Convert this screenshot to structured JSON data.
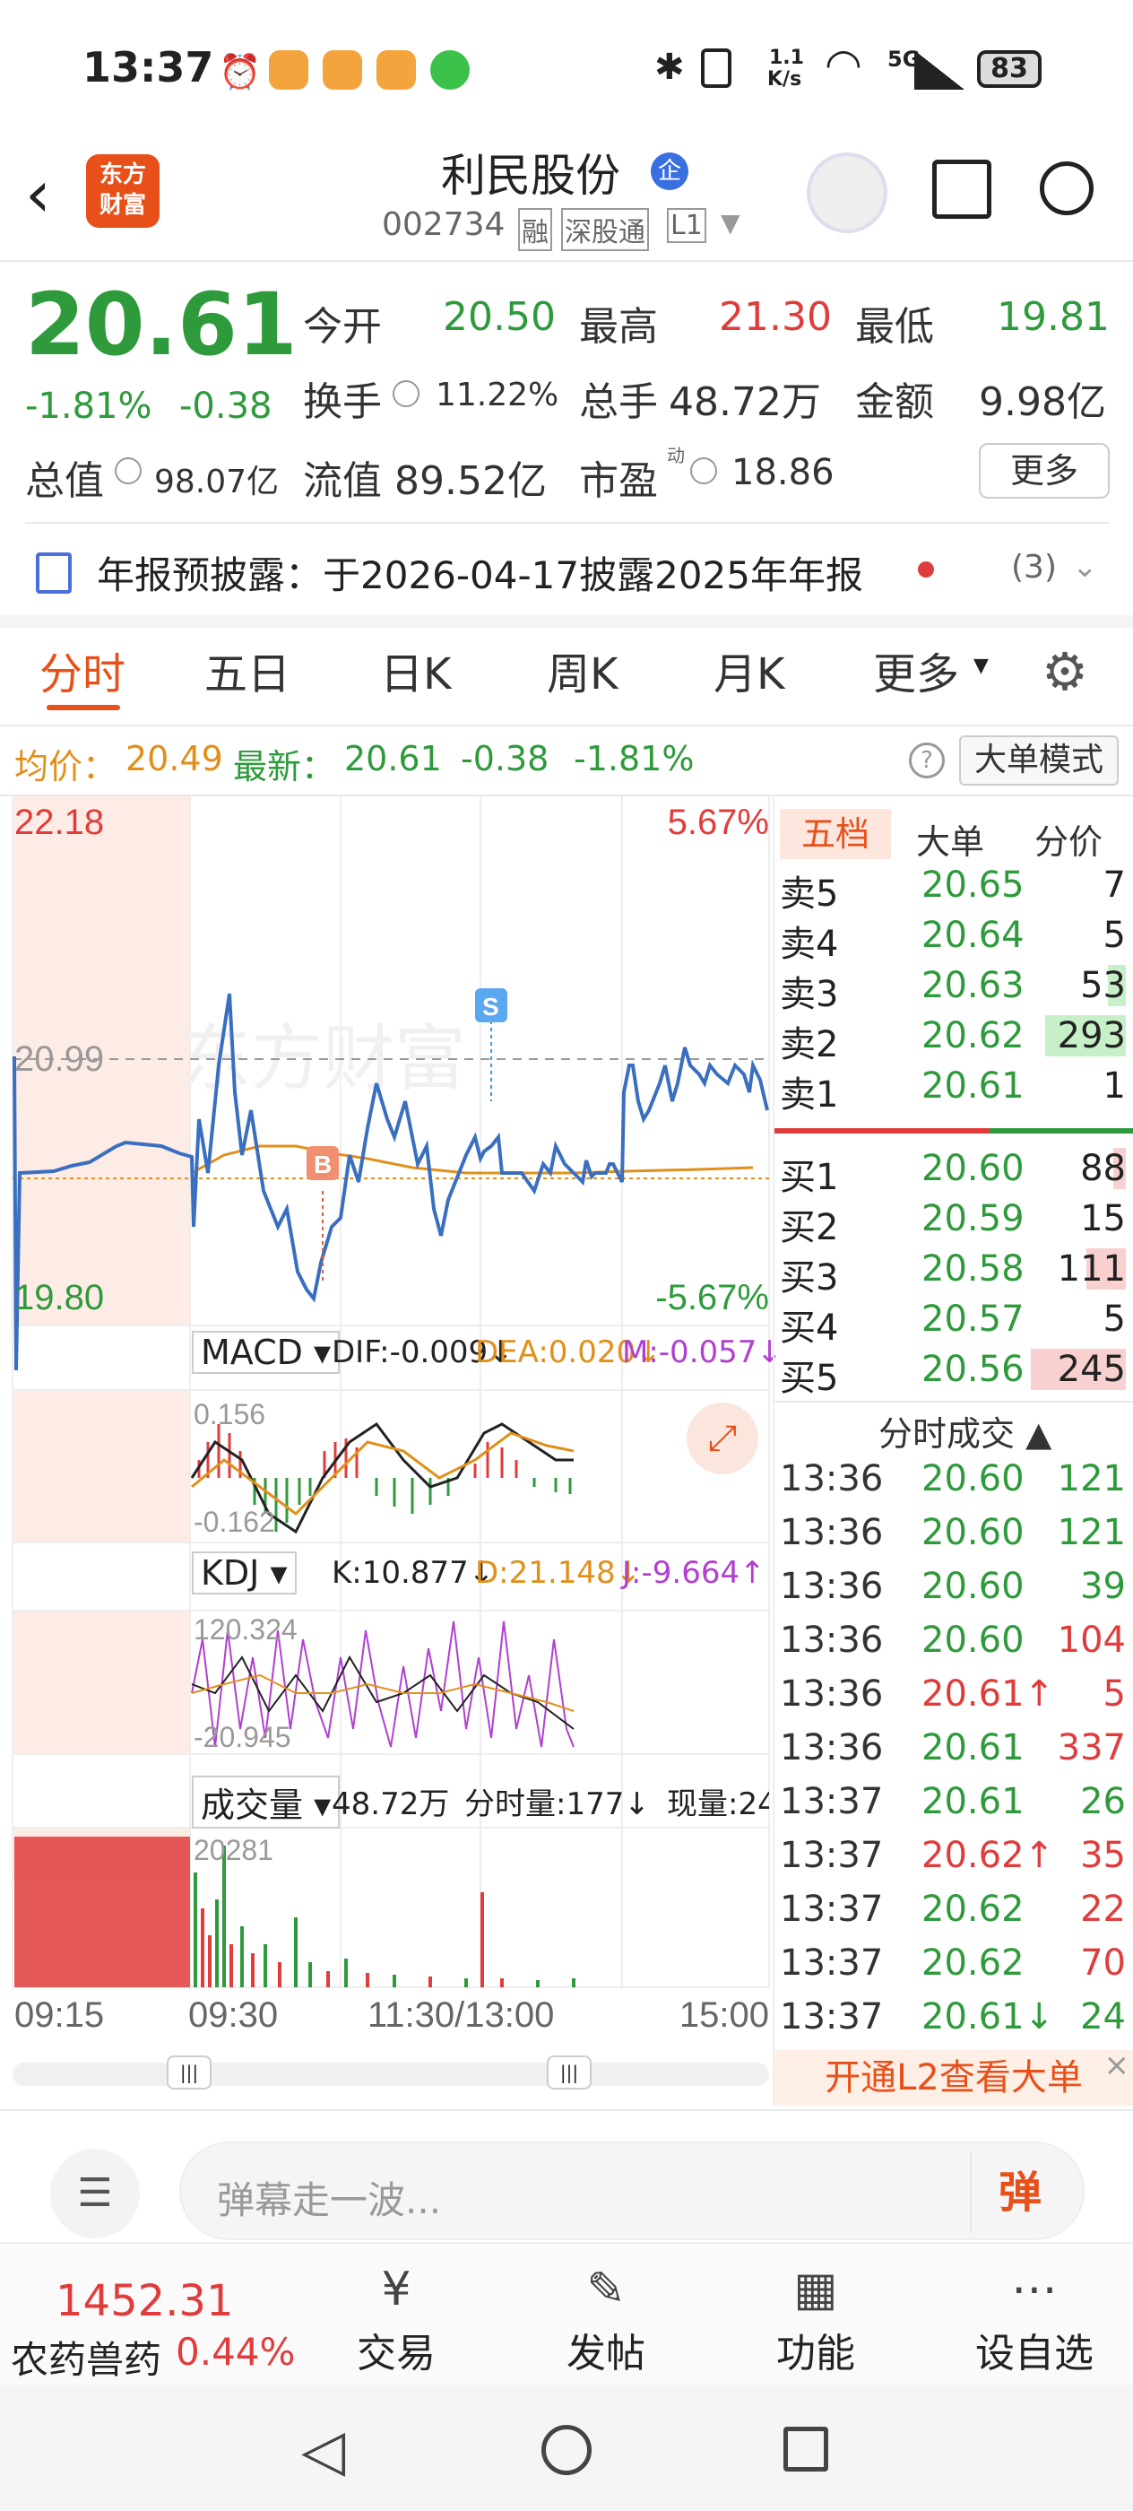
{
  "status": {
    "time": "13:37",
    "net_top": "1.1",
    "net_bottom": "K/s",
    "net_type": "5G",
    "battery": "83"
  },
  "header": {
    "logo_line1": "东方",
    "logo_line2": "财富",
    "stock_name": "利民股份",
    "badge": "企",
    "code": "002734",
    "tag1": "融",
    "tag2": "深股通",
    "tag3": "L1"
  },
  "quote": {
    "price": "20.61",
    "change_pct": "-1.81%",
    "change": "-0.38",
    "open_label": "今开",
    "open": "20.50",
    "high_label": "最高",
    "high": "21.30",
    "low_label": "最低",
    "low": "19.81",
    "turnover_label": "换手",
    "turnover": "11.22%",
    "volume_label": "总手",
    "volume": "48.72万",
    "amount_label": "金额",
    "amount": "9.98亿",
    "mktcap_label": "总值",
    "mktcap": "98.07亿",
    "float_label": "流值",
    "float_cap": "89.52亿",
    "pe_label": "市盈",
    "pe_sup": "动",
    "pe": "18.86",
    "more": "更多"
  },
  "notice": {
    "text": "年报预披露：于2026-04-17披露2025年年报",
    "count": "(3)"
  },
  "tabs": [
    "分时",
    "五日",
    "日K",
    "周K",
    "月K",
    "更多"
  ],
  "avg_bar": {
    "avg_label": "均价：",
    "avg": "20.49",
    "latest_label": "最新：",
    "latest": "20.61",
    "chg": "-0.38",
    "chg_pct": "-1.81%",
    "mode": "大单模式"
  },
  "chart_labels": {
    "ymax": "22.18",
    "ymid": "20.99",
    "ymin": "19.80",
    "pmax": "5.67%",
    "pmin": "-5.67%",
    "watermark": "东方财富",
    "buy_marker": "B",
    "sell_marker": "S"
  },
  "macd": {
    "name": "MACD",
    "dif": "DIF:-0.009↓",
    "dea": "DEA:0.020↓",
    "m": "M:-0.057↓",
    "top": "0.156",
    "bottom": "-0.162"
  },
  "kdj": {
    "name": "KDJ",
    "k": "K:10.877↓",
    "d": "D:21.148↓",
    "j": "J:-9.664↑",
    "top": "120.324",
    "bottom": "-20.945"
  },
  "vol": {
    "name": "成交量",
    "total": "48.72万",
    "bar_label": "分时量:177↓",
    "now_label": "现量:24",
    "top": "20281"
  },
  "xaxis": [
    "09:15",
    "09:30",
    "11:30/13:00",
    "15:00"
  ],
  "orderbook": {
    "tabs": [
      "五档",
      "大单",
      "分价"
    ],
    "asks": [
      {
        "label": "卖5",
        "price": "20.65",
        "vol": "7"
      },
      {
        "label": "卖4",
        "price": "20.64",
        "vol": "5"
      },
      {
        "label": "卖3",
        "price": "20.63",
        "vol": "53"
      },
      {
        "label": "卖2",
        "price": "20.62",
        "vol": "293"
      },
      {
        "label": "卖1",
        "price": "20.61",
        "vol": "1"
      }
    ],
    "bids": [
      {
        "label": "买1",
        "price": "20.60",
        "vol": "88"
      },
      {
        "label": "买2",
        "price": "20.59",
        "vol": "15"
      },
      {
        "label": "买3",
        "price": "20.58",
        "vol": "111"
      },
      {
        "label": "买4",
        "price": "20.57",
        "vol": "5"
      },
      {
        "label": "买5",
        "price": "20.56",
        "vol": "245"
      }
    ]
  },
  "trades": {
    "title": "分时成交",
    "rows": [
      {
        "t": "13:36",
        "p": "20.60",
        "v": "121",
        "c": "g"
      },
      {
        "t": "13:36",
        "p": "20.60",
        "v": "121",
        "c": "g"
      },
      {
        "t": "13:36",
        "p": "20.60",
        "v": "39",
        "c": "g"
      },
      {
        "t": "13:36",
        "p": "20.60",
        "v": "104",
        "c": "r"
      },
      {
        "t": "13:36",
        "p": "20.61↑",
        "v": "5",
        "c": "r"
      },
      {
        "t": "13:36",
        "p": "20.61",
        "v": "337",
        "c": "r"
      },
      {
        "t": "13:37",
        "p": "20.61",
        "v": "26",
        "c": "g"
      },
      {
        "t": "13:37",
        "p": "20.62↑",
        "v": "35",
        "c": "r"
      },
      {
        "t": "13:37",
        "p": "20.62",
        "v": "22",
        "c": "r"
      },
      {
        "t": "13:37",
        "p": "20.62",
        "v": "70",
        "c": "r"
      },
      {
        "t": "13:37",
        "p": "20.61↓",
        "v": "24",
        "c": "g"
      }
    ],
    "l2_promo": "开通L2查看大单"
  },
  "danmu": {
    "placeholder": "弹幕走一波...",
    "btn": "弹"
  },
  "bottom": {
    "index_value": "1452.31",
    "index_name": "农药兽药",
    "index_pct": "0.44%",
    "items": [
      "交易",
      "发帖",
      "功能",
      "设自选"
    ]
  },
  "colors": {
    "up": "#e03c3c",
    "down": "#2f9a3c",
    "avg": "#e0901a",
    "accent": "#e8501a"
  }
}
